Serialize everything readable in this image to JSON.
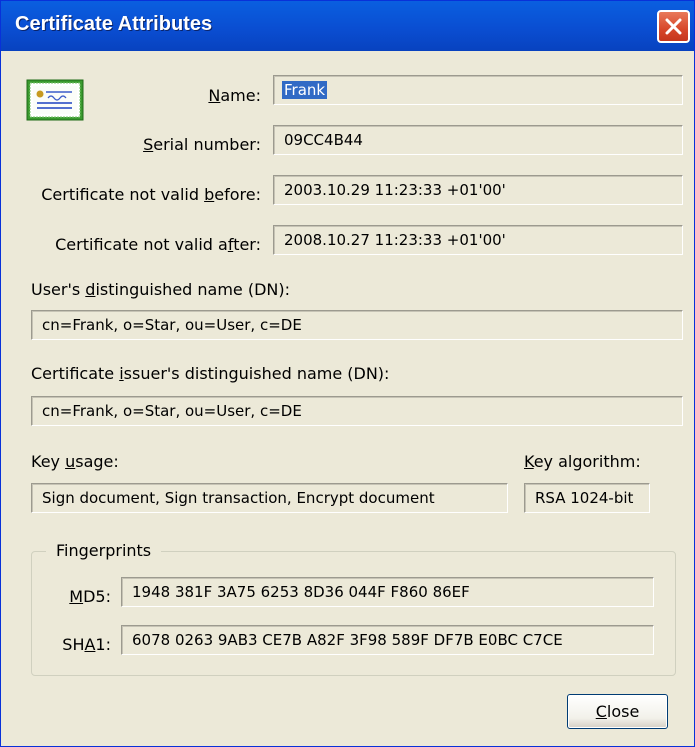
{
  "window": {
    "title": "Certificate Attributes",
    "close_glyph": "close-icon"
  },
  "labels": {
    "name_pre": "",
    "name_u": "N",
    "name_post": "ame:",
    "serial_pre": "",
    "serial_u": "S",
    "serial_post": "erial number:",
    "before_pre": "Certificate not valid ",
    "before_u": "b",
    "before_post": "efore:",
    "after_pre": "Certificate not valid a",
    "after_u": "f",
    "after_post": "ter:",
    "user_dn_pre": "User's ",
    "user_dn_u": "d",
    "user_dn_post": "istinguished name (DN):",
    "issuer_dn_pre": "Certificate ",
    "issuer_dn_u": "i",
    "issuer_dn_post": "ssuer's distinguished name (DN):",
    "key_usage_pre": "Key ",
    "key_usage_u": "u",
    "key_usage_post": "sage:",
    "key_algo_pre": "",
    "key_algo_u": "K",
    "key_algo_post": "ey algorithm:",
    "fingerprints": "Fingerprints",
    "md5_pre": "",
    "md5_u": "M",
    "md5_post": "D5:",
    "sha1_pre": "SH",
    "sha1_u": "A",
    "sha1_post": "1:"
  },
  "values": {
    "name": "Frank",
    "serial": "09CC4B44",
    "not_before": "2003.10.29 11:23:33 +01'00'",
    "not_after": "2008.10.27 11:23:33 +01'00'",
    "user_dn": "cn=Frank, o=Star, ou=User, c=DE",
    "issuer_dn": "cn=Frank, o=Star, ou=User, c=DE",
    "key_usage": "Sign document, Sign transaction, Encrypt document",
    "key_algorithm": "RSA 1024-bit",
    "md5": "1948 381F 3A75 6253 8D36 044F F860 86EF",
    "sha1": "6078 0263 9AB3 CE7B A82F 3F98 589F DF7B E0BC C7CE"
  },
  "buttons": {
    "close_pre": "",
    "close_u": "C",
    "close_post": "lose"
  },
  "icons": {
    "certificate": "certificate-icon"
  },
  "colors": {
    "titlebar": "#0a4ed2",
    "dialog_bg": "#ece9d8",
    "selection": "#316ac5",
    "close_button": "#d7472a"
  }
}
